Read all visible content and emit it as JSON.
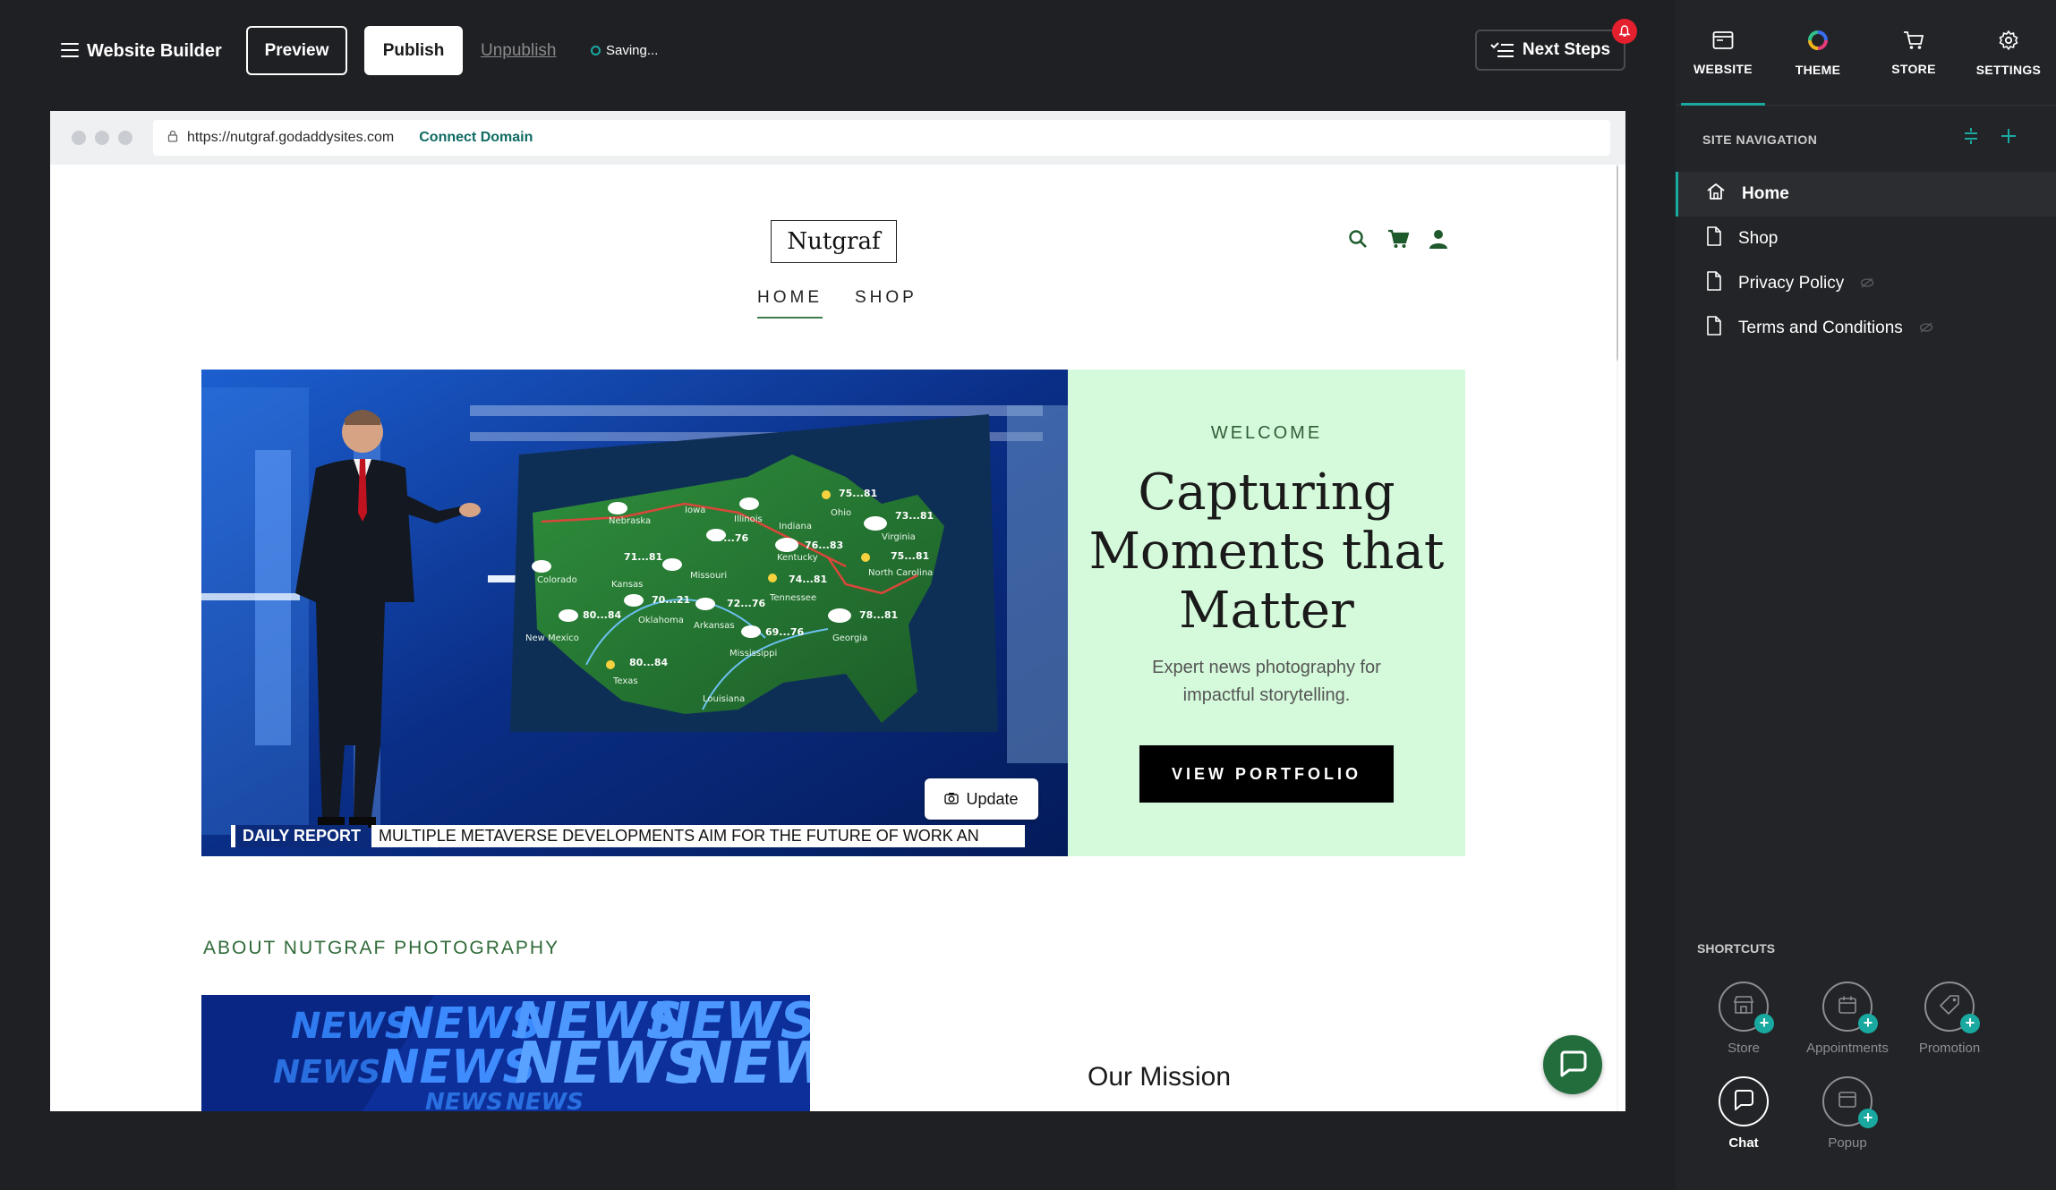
{
  "topbar": {
    "app_title": "Website Builder",
    "preview_label": "Preview",
    "publish_label": "Publish",
    "unpublish_label": "Unpublish",
    "status_text": "Saving...",
    "next_steps_label": "Next Steps"
  },
  "browser": {
    "url": "https://nutgraf.godaddysites.com",
    "connect_domain_label": "Connect Domain"
  },
  "site": {
    "logo_text": "Nutgraf",
    "nav": [
      {
        "label": "HOME",
        "active": true
      },
      {
        "label": "SHOP",
        "active": false
      }
    ],
    "hero": {
      "eyebrow": "WELCOME",
      "title": "Capturing Moments that Matter",
      "subtitle": "Expert news photography for impactful storytelling.",
      "cta_label": "VIEW PORTFOLIO",
      "update_label": "Update",
      "ticker_tag": "DAILY REPORT",
      "ticker_text": "MULTIPLE METAVERSE DEVELOPMENTS AIM FOR THE FUTURE OF WORK AN",
      "map_labels": [
        {
          "text": "Nebraska"
        },
        {
          "text": "Iowa"
        },
        {
          "text": "Illinois"
        },
        {
          "text": "Ohio"
        },
        {
          "text": "Indiana"
        },
        {
          "text": "Virginia"
        },
        {
          "text": "Kentucky"
        },
        {
          "text": "North Carolina"
        },
        {
          "text": "Colorado"
        },
        {
          "text": "Kansas"
        },
        {
          "text": "Missouri"
        },
        {
          "text": "Tennessee"
        },
        {
          "text": "Oklahoma"
        },
        {
          "text": "Arkansas"
        },
        {
          "text": "Georgia"
        },
        {
          "text": "New Mexico"
        },
        {
          "text": "Mississippi"
        },
        {
          "text": "Texas"
        },
        {
          "text": "Louisiana"
        }
      ],
      "map_temps": [
        "75...81",
        "73...81",
        "69...76",
        "76...83",
        "75...81",
        "71...81",
        "74...81",
        "70...21",
        "72...76",
        "78...81",
        "80...84",
        "69...76",
        "80...84"
      ]
    },
    "about_heading": "ABOUT NUTGRAF PHOTOGRAPHY",
    "news_banner_word": "NEWS",
    "mission_heading": "Our Mission"
  },
  "rpanel": {
    "tabs": [
      {
        "label": "WEBSITE",
        "icon": "browser-window-icon",
        "active": true
      },
      {
        "label": "THEME",
        "icon": "color-wheel-icon",
        "active": false
      },
      {
        "label": "STORE",
        "icon": "cart-icon",
        "active": false
      },
      {
        "label": "SETTINGS",
        "icon": "gear-icon",
        "active": false
      }
    ],
    "site_navigation_title": "SITE NAVIGATION",
    "pages": [
      {
        "label": "Home",
        "icon": "home-icon",
        "active": true,
        "hidden": false
      },
      {
        "label": "Shop",
        "icon": "page-icon",
        "active": false,
        "hidden": false
      },
      {
        "label": "Privacy Policy",
        "icon": "page-icon",
        "active": false,
        "hidden": true
      },
      {
        "label": "Terms and Conditions",
        "icon": "page-icon",
        "active": false,
        "hidden": true
      }
    ],
    "shortcuts_title": "SHORTCUTS",
    "shortcuts": [
      {
        "label": "Store",
        "icon": "storefront-icon"
      },
      {
        "label": "Appointments",
        "icon": "calendar-icon"
      },
      {
        "label": "Promotion",
        "icon": "tag-icon"
      },
      {
        "label": "Chat",
        "icon": "chat-icon",
        "active": true
      },
      {
        "label": "Popup",
        "icon": "popup-window-icon"
      }
    ]
  },
  "colors": {
    "accent_teal": "#19a9a0",
    "brand_green": "#2f6a38",
    "hero_panel_bg": "#d5fadb",
    "badge_red": "#e4202e"
  }
}
